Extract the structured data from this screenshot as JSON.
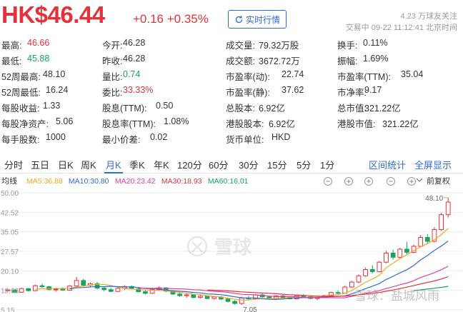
{
  "header": {
    "price": "HK$46.44",
    "change": "+0.16 +0.35%",
    "realtime_button": "实时行情",
    "followers": "4.23 万球友关注",
    "trade_time": "交易中 09-22 11:12:41 北京时间"
  },
  "stats": [
    {
      "label": "最高:",
      "value": "46.66",
      "color": "red"
    },
    {
      "label": "今开:",
      "value": "46.28",
      "color": ""
    },
    {
      "label": "成交量:",
      "value": "79.32万股",
      "color": ""
    },
    {
      "label": "换手:",
      "value": "0.11%",
      "color": ""
    },
    {
      "label": "最低:",
      "value": "45.88",
      "color": "green"
    },
    {
      "label": "昨收:",
      "value": "46.28",
      "color": ""
    },
    {
      "label": "成交额:",
      "value": "3672.72万",
      "color": ""
    },
    {
      "label": "振幅:",
      "value": "1.69%",
      "color": ""
    },
    {
      "label": "52周最高:",
      "value": "48.10",
      "color": ""
    },
    {
      "label": "量比:",
      "value": "0.74",
      "color": "green"
    },
    {
      "label": "市盈率(动):",
      "value": "22.74",
      "color": ""
    },
    {
      "label": "市盈率(TTM):",
      "value": "35.04",
      "color": ""
    },
    {
      "label": "52周最低:",
      "value": "16.24",
      "color": ""
    },
    {
      "label": "委比:",
      "value": "33.33%",
      "color": "red"
    },
    {
      "label": "市盈率(静):",
      "value": "37.62",
      "color": ""
    },
    {
      "label": "市净率:",
      "value": "9.17",
      "color": ""
    },
    {
      "label": "每股收益:",
      "value": "1.33",
      "color": ""
    },
    {
      "label": "股息(TTM):",
      "value": "0.50",
      "color": ""
    },
    {
      "label": "总股本:",
      "value": "6.92亿",
      "color": ""
    },
    {
      "label": "总市值:",
      "value": "321.22亿",
      "color": ""
    },
    {
      "label": "每股净资产:",
      "value": "5.06",
      "color": ""
    },
    {
      "label": "股息率(TTM):",
      "value": "1.08%",
      "color": ""
    },
    {
      "label": "港股股本:",
      "value": "6.92亿",
      "color": ""
    },
    {
      "label": "港股市值:",
      "value": "321.22亿",
      "color": ""
    },
    {
      "label": "每手股数:",
      "value": "1000",
      "color": ""
    },
    {
      "label": "最小价差:",
      "value": "0.02",
      "color": ""
    },
    {
      "label": "货币单位:",
      "value": "HKD",
      "color": ""
    }
  ],
  "tabs": [
    "分时",
    "五日",
    "日K",
    "周K",
    "月K",
    "季K",
    "年K",
    "120分",
    "60分",
    "30分",
    "15分",
    "5分",
    "1分"
  ],
  "active_tab": "月K",
  "links": {
    "interval_stats": "区间统计",
    "fullscreen": "全屏显示"
  },
  "chart_controls": {
    "mode": "均线",
    "adjust": "前复权",
    "ma_labels": [
      {
        "text": "MA5:36.88",
        "color": "#f5a623"
      },
      {
        "text": "MA10:30.80",
        "color": "#2f6bd5"
      },
      {
        "text": "MA20:23.42",
        "color": "#e040a0"
      },
      {
        "text": "MA30:18.93",
        "color": "#e4313a"
      },
      {
        "text": "MA60:16.01",
        "color": "#1ba35d"
      }
    ]
  },
  "watermark": {
    "logo_text": "雪球",
    "credit_text": "雪球：盐城风雨"
  },
  "chart_data": {
    "type": "candlestick",
    "y_ticks": [
      "50.00",
      "42.52",
      "35.05",
      "27.57",
      "20.10",
      "12.63",
      "5.15"
    ],
    "ylim": [
      5.15,
      50.0
    ],
    "max_label": "48.10",
    "min_label": "7.05",
    "candles": [
      [
        12.5,
        13.2,
        12.0,
        12.8
      ],
      [
        12.8,
        12.9,
        11.6,
        11.9
      ],
      [
        11.9,
        13.6,
        11.7,
        13.3
      ],
      [
        13.3,
        13.5,
        12.3,
        12.5
      ],
      [
        12.5,
        14.8,
        12.3,
        14.4
      ],
      [
        14.4,
        15.2,
        13.6,
        14.0
      ],
      [
        14.0,
        14.3,
        12.6,
        12.9
      ],
      [
        12.9,
        13.4,
        12.1,
        13.1
      ],
      [
        13.1,
        13.8,
        12.4,
        12.7
      ],
      [
        12.7,
        14.6,
        12.5,
        14.3
      ],
      [
        14.3,
        17.8,
        14.0,
        16.4
      ],
      [
        16.4,
        17.0,
        14.1,
        14.6
      ],
      [
        14.6,
        15.6,
        13.8,
        15.2
      ],
      [
        15.2,
        15.9,
        13.0,
        13.5
      ],
      [
        13.5,
        14.1,
        12.3,
        12.9
      ],
      [
        12.9,
        13.6,
        11.9,
        12.2
      ],
      [
        12.2,
        13.9,
        12.0,
        13.4
      ],
      [
        13.4,
        14.6,
        12.8,
        14.1
      ],
      [
        14.1,
        14.5,
        12.9,
        13.2
      ],
      [
        13.2,
        13.5,
        11.8,
        12.1
      ],
      [
        12.1,
        12.8,
        11.0,
        11.5
      ],
      [
        11.5,
        13.4,
        11.3,
        12.9
      ],
      [
        12.9,
        14.1,
        12.4,
        13.6
      ],
      [
        13.6,
        13.8,
        12.0,
        12.3
      ],
      [
        12.3,
        12.7,
        10.9,
        11.2
      ],
      [
        11.2,
        11.9,
        10.1,
        10.6
      ],
      [
        10.6,
        11.3,
        9.8,
        10.9
      ],
      [
        10.9,
        11.0,
        9.6,
        9.9
      ],
      [
        9.9,
        10.8,
        9.5,
        10.4
      ],
      [
        10.4,
        10.7,
        9.2,
        9.5
      ],
      [
        9.5,
        10.4,
        9.1,
        10.1
      ],
      [
        10.1,
        10.5,
        8.9,
        9.3
      ],
      [
        9.3,
        9.8,
        8.0,
        8.4
      ],
      [
        8.4,
        8.9,
        7.1,
        7.6
      ],
      [
        7.6,
        10.2,
        7.05,
        9.7
      ],
      [
        9.7,
        10.5,
        9.0,
        9.4
      ],
      [
        9.4,
        11.3,
        9.2,
        10.9
      ],
      [
        10.9,
        11.4,
        9.8,
        10.1
      ],
      [
        10.1,
        10.6,
        9.3,
        9.6
      ],
      [
        9.6,
        10.8,
        9.4,
        10.5
      ],
      [
        10.5,
        11.0,
        9.6,
        9.9
      ],
      [
        9.9,
        10.4,
        9.1,
        9.4
      ],
      [
        9.4,
        10.9,
        9.2,
        10.6
      ],
      [
        10.6,
        11.2,
        9.9,
        10.2
      ],
      [
        10.2,
        10.6,
        9.2,
        9.5
      ],
      [
        9.5,
        10.1,
        8.9,
        9.8
      ],
      [
        9.8,
        10.9,
        9.6,
        10.6
      ],
      [
        10.6,
        12.1,
        10.4,
        11.8
      ],
      [
        11.8,
        12.6,
        11.2,
        11.5
      ],
      [
        11.5,
        14.4,
        11.3,
        13.9
      ],
      [
        13.9,
        16.2,
        13.6,
        15.8
      ],
      [
        15.8,
        18.7,
        15.4,
        18.2
      ],
      [
        18.2,
        21.4,
        17.9,
        20.6
      ],
      [
        20.6,
        22.3,
        19.1,
        19.8
      ],
      [
        19.8,
        23.9,
        19.5,
        23.4
      ],
      [
        23.4,
        27.8,
        23.0,
        26.9
      ],
      [
        26.9,
        28.2,
        24.4,
        25.3
      ],
      [
        25.3,
        28.9,
        24.9,
        28.4
      ],
      [
        28.4,
        31.2,
        26.5,
        27.2
      ],
      [
        27.2,
        30.1,
        26.8,
        29.5
      ],
      [
        29.5,
        33.8,
        29.1,
        32.9
      ],
      [
        32.9,
        34.2,
        30.3,
        31.4
      ],
      [
        31.4,
        36.8,
        31.0,
        35.9
      ],
      [
        35.9,
        42.3,
        35.4,
        41.6
      ],
      [
        41.6,
        48.1,
        40.5,
        46.44
      ]
    ],
    "series": [
      {
        "name": "MA5",
        "color": "#f5a623",
        "values": [
          null,
          null,
          null,
          null,
          12.98,
          13.24,
          13.18,
          13.42,
          13.32,
          13.4,
          13.88,
          14.22,
          14.64,
          14.96,
          14.92,
          14.44,
          13.84,
          13.22,
          13.16,
          12.88,
          12.74,
          12.66,
          12.64,
          12.48,
          12.06,
          11.84,
          11.54,
          11.14,
          10.98,
          10.58,
          10.28,
          10.04,
          9.62,
          9.22,
          8.94,
          8.96,
          9.22,
          9.44,
          9.52,
          9.56,
          9.62,
          9.98,
          10.1,
          10.04,
          10.04,
          10.08,
          10.48,
          10.86,
          10.98,
          11.48,
          12.58,
          14.16,
          15.68,
          16.98,
          18.42,
          21.3,
          23.04,
          24.82,
          26.2,
          27.86,
          29.26,
          30.56,
          32.04,
          33.98,
          36.38
        ]
      },
      {
        "name": "MA10",
        "color": "#2f6bd5",
        "values": [
          null,
          null,
          null,
          null,
          null,
          null,
          null,
          null,
          null,
          13.21,
          13.56,
          13.7,
          13.93,
          14.09,
          14.04,
          14.18,
          14.03,
          13.93,
          13.93,
          13.72,
          13.31,
          13.25,
          13.1,
          12.72,
          12.46,
          12.25,
          12.12,
          11.82,
          11.66,
          11.26,
          11.17,
          10.97,
          10.58,
          10.16,
          9.76,
          9.73,
          9.69,
          9.4,
          9.19,
          9.14,
          9.29,
          9.6,
          9.75,
          9.84,
          9.82,
          9.85,
          10.04,
          10.25,
          10.29,
          10.48,
          11.33,
          12.27,
          13.27,
          14.24,
          15.22,
          16.79,
          18.01,
          19.32,
          20.53,
          22.14,
          24.29,
          26.01,
          27.94,
          29.59,
          31.51
        ]
      },
      {
        "name": "MA20",
        "color": "#e040a0",
        "values": [
          null,
          null,
          null,
          null,
          null,
          null,
          null,
          null,
          null,
          null,
          null,
          null,
          null,
          null,
          null,
          null,
          null,
          null,
          null,
          13.47,
          13.44,
          13.41,
          13.42,
          13.41,
          13.25,
          13.22,
          13.08,
          12.87,
          12.79,
          12.49,
          12.24,
          12.11,
          11.84,
          11.44,
          11.11,
          10.99,
          10.9,
          10.61,
          10.43,
          10.2,
          10.23,
          10.28,
          10.16,
          10.0,
          9.79,
          9.79,
          9.86,
          9.83,
          9.74,
          9.81,
          10.31,
          10.93,
          11.51,
          12.04,
          12.52,
          13.32,
          14.02,
          14.78,
          15.41,
          16.31,
          17.56,
          18.44,
          19.36,
          20.55,
          21.82
        ]
      },
      {
        "name": "MA30",
        "color": "#e4313a",
        "values": [
          null,
          null,
          null,
          null,
          null,
          null,
          null,
          null,
          null,
          null,
          null,
          null,
          null,
          null,
          null,
          null,
          null,
          null,
          null,
          null,
          null,
          null,
          null,
          null,
          null,
          null,
          null,
          null,
          null,
          12.78,
          12.66,
          12.55,
          12.42,
          12.22,
          12.03,
          11.87,
          11.78,
          11.6,
          11.49,
          11.33,
          11.15,
          10.94,
          10.85,
          10.68,
          10.53,
          10.41,
          10.33,
          10.33,
          10.36,
          10.43,
          10.62,
          10.9,
          11.17,
          11.48,
          11.79,
          12.3,
          12.76,
          13.3,
          13.84,
          14.43,
          15.09,
          15.64,
          16.22,
          16.96,
          17.85
        ]
      },
      {
        "name": "MA60",
        "color": "#1ba35d",
        "values": [
          null,
          null,
          null,
          null,
          null,
          null,
          null,
          null,
          null,
          null,
          null,
          null,
          null,
          null,
          null,
          null,
          null,
          null,
          null,
          null,
          null,
          null,
          null,
          null,
          null,
          null,
          null,
          null,
          null,
          null,
          null,
          null,
          null,
          null,
          null,
          null,
          null,
          null,
          null,
          null,
          null,
          null,
          null,
          null,
          null,
          null,
          null,
          null,
          null,
          null,
          null,
          null,
          null,
          null,
          null,
          null,
          null,
          null,
          null,
          12.53,
          12.82,
          13.12,
          13.43,
          13.77,
          14.18
        ]
      }
    ]
  }
}
